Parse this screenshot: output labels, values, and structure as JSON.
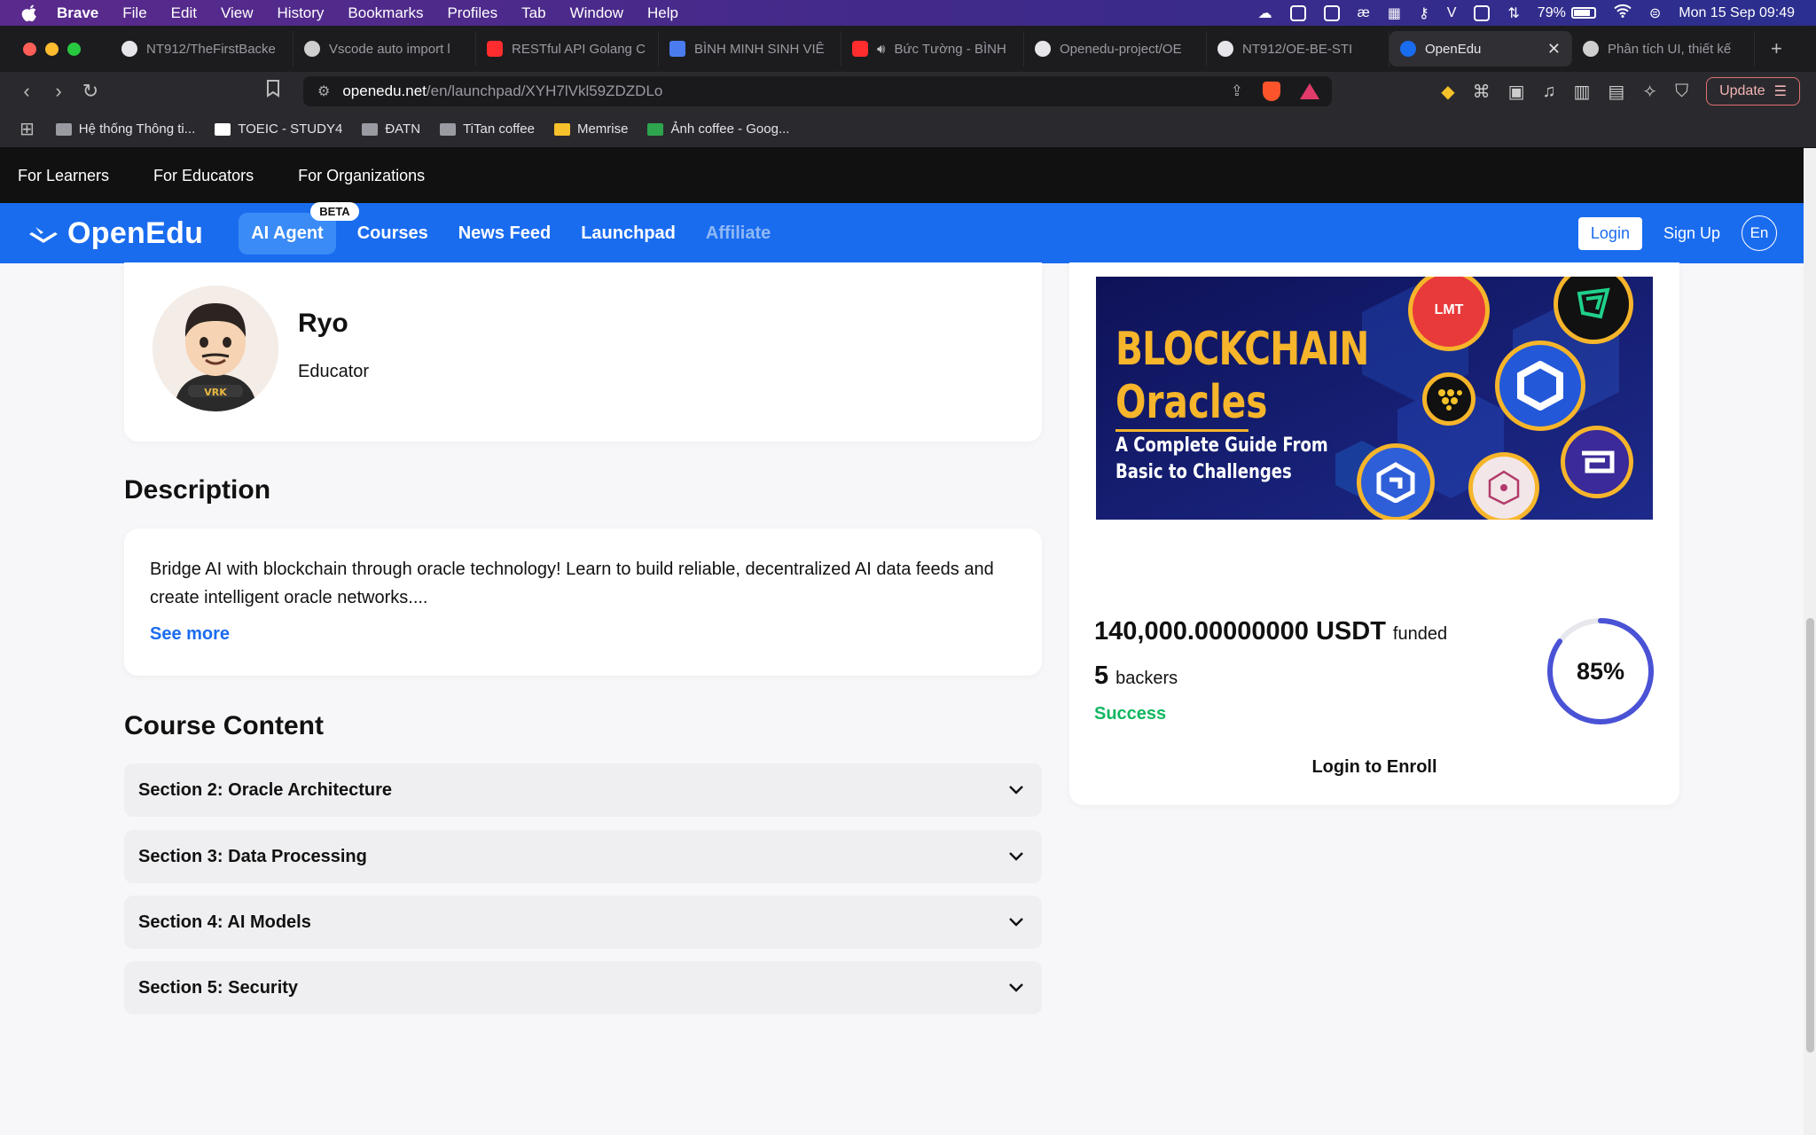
{
  "macos": {
    "app_name": "Brave",
    "menus": [
      "File",
      "Edit",
      "View",
      "History",
      "Bookmarks",
      "Profiles",
      "Tab",
      "Window",
      "Help"
    ],
    "battery": "79%",
    "clock": "Mon 15 Sep  09:49"
  },
  "browser": {
    "tabs": [
      {
        "title": "NT912/TheFirstBacke",
        "color": "#e6e6ea"
      },
      {
        "title": "Vscode auto import l",
        "color": "#cfcfcf"
      },
      {
        "title": "RESTful API Golang C",
        "color": "#ff2d2d"
      },
      {
        "title": "BÌNH MINH SINH VIÊ",
        "color": "#4a7cf0"
      },
      {
        "title": "Bức Tường - BÌNH",
        "color": "#ff2d2d"
      },
      {
        "title": "Openedu-project/OE",
        "color": "#e6e6ea"
      },
      {
        "title": "NT912/OE-BE-STI",
        "color": "#e6e6ea"
      },
      {
        "title": "OpenEdu",
        "color": "#1a6cef"
      },
      {
        "title": "Phân tích UI, thiết kế",
        "color": "#cfcfcf"
      }
    ],
    "address_domain": "openedu.net",
    "address_path": "/en/launchpad/XYH7lVkl59ZDZDLo",
    "update_label": "Update",
    "bookmarks": [
      "Hệ thống Thông ti...",
      "TOEIC - STUDY4",
      "ĐATN",
      "TiTan coffee",
      "Memrise",
      "Ảnh coffee - Goog..."
    ]
  },
  "site": {
    "top_links": [
      "For Learners",
      "For Educators",
      "For Organizations"
    ],
    "logo_text": "OpenEdu",
    "nav": {
      "ai_agent": "AI Agent",
      "beta": "BETA",
      "courses": "Courses",
      "news_feed": "News Feed",
      "launchpad": "Launchpad",
      "affiliate": "Affiliate",
      "login": "Login",
      "signup": "Sign Up",
      "lang": "En"
    }
  },
  "educator": {
    "name": "Ryo",
    "role": "Educator"
  },
  "description": {
    "heading": "Description",
    "text": "Bridge AI with blockchain through oracle technology! Learn to build reliable, decentralized AI data feeds and create intelligent oracle networks....",
    "see_more": "See more"
  },
  "course_content": {
    "heading": "Course Content",
    "sections": [
      "Section 2: Oracle Architecture",
      "Section 3: Data Processing",
      "Section 4: AI Models",
      "Section 5: Security"
    ]
  },
  "campaign": {
    "banner_title_1": "BLOCKCHAIN",
    "banner_title_2": "Oracles",
    "banner_subtitle_1": "A Complete Guide From",
    "banner_subtitle_2": "Basic to Challenges",
    "funded_amount": "140,000.00000000 USDT",
    "funded_label": "funded",
    "backers_count": "5",
    "backers_label": "backers",
    "status": "Success",
    "progress_percent_text": "85%",
    "progress": 0.85,
    "enroll_label": "Login to Enroll"
  }
}
